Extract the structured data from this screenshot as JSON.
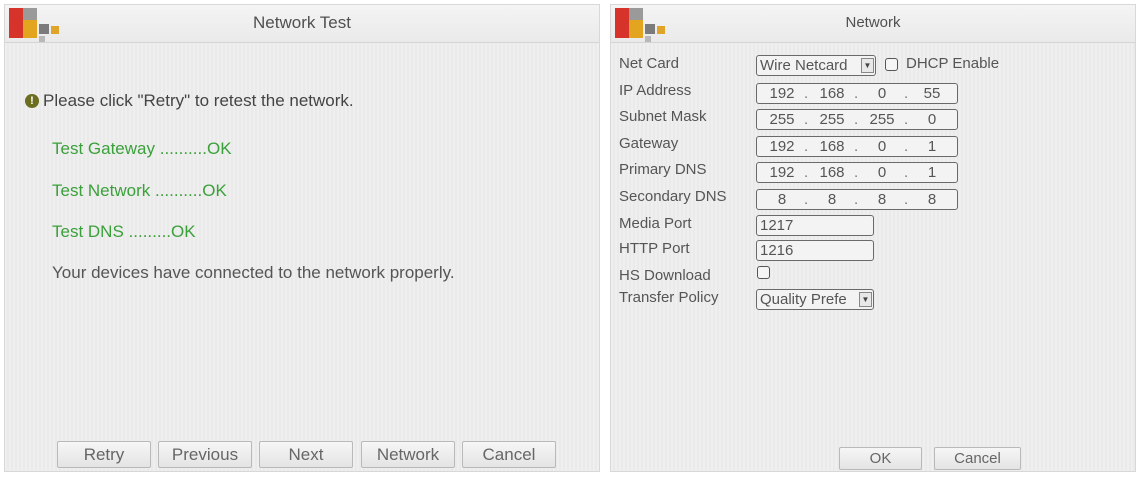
{
  "left_dialog": {
    "title": "Network Test",
    "info_message": "Please click \"Retry\" to retest the network.",
    "tests": [
      {
        "name": "Test Gateway",
        "dots": " ..........",
        "status": "OK"
      },
      {
        "name": "Test Network",
        "dots": " ..........",
        "status": "OK"
      },
      {
        "name": "Test DNS",
        "dots": " .........",
        "status": "OK"
      }
    ],
    "result_message": "Your devices have connected to the network properly.",
    "buttons": {
      "retry": "Retry",
      "previous": "Previous",
      "next": "Next",
      "network": "Network",
      "cancel": "Cancel"
    },
    "colors": {
      "ok_text": "#3aa03a",
      "info_icon": "#6b6e1e"
    }
  },
  "right_dialog": {
    "title": "Network",
    "fields": {
      "net_card": {
        "label": "Net Card",
        "value": "Wire Netcard"
      },
      "dhcp": {
        "label": "DHCP Enable",
        "checked": false
      },
      "ip_address": {
        "label": "IP Address",
        "octets": [
          "192",
          "168",
          "0",
          "55"
        ]
      },
      "subnet_mask": {
        "label": "Subnet Mask",
        "octets": [
          "255",
          "255",
          "255",
          "0"
        ]
      },
      "gateway": {
        "label": "Gateway",
        "octets": [
          "192",
          "168",
          "0",
          "1"
        ]
      },
      "primary_dns": {
        "label": "Primary DNS",
        "octets": [
          "192",
          "168",
          "0",
          "1"
        ]
      },
      "secondary_dns": {
        "label": "Secondary DNS",
        "octets": [
          "8",
          "8",
          "8",
          "8"
        ]
      },
      "media_port": {
        "label": "Media Port",
        "value": "1217"
      },
      "http_port": {
        "label": "HTTP Port",
        "value": "1216"
      },
      "hs_download": {
        "label": "HS Download",
        "checked": false
      },
      "transfer_policy": {
        "label": "Transfer Policy",
        "value": "Quality Prefe"
      }
    },
    "buttons": {
      "ok": "OK",
      "cancel": "Cancel"
    }
  }
}
